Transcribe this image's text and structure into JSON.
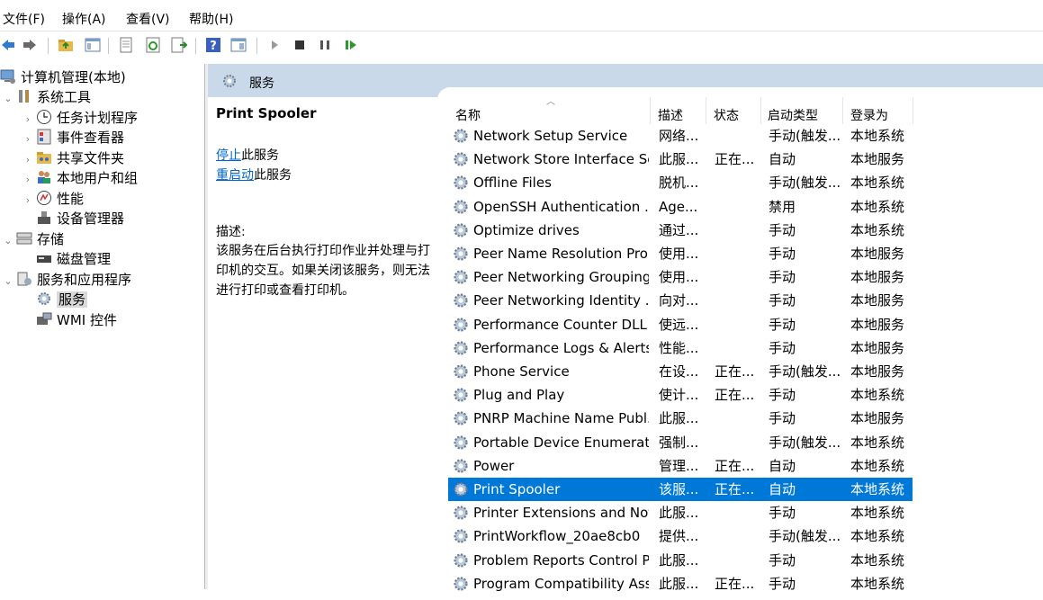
{
  "menubar": {
    "items": [
      "文件(F)",
      "操作(A)",
      "查看(V)",
      "帮助(H)"
    ]
  },
  "toolbar": {
    "buttons": [
      "back-icon",
      "forward-icon",
      "up-folder-icon",
      "show-hide-tree-icon",
      "properties-icon",
      "refresh-icon",
      "export-list-icon",
      "help-icon",
      "show-action-pane-icon",
      "play-icon",
      "stop-icon",
      "pause-icon",
      "resume-icon"
    ]
  },
  "tree": {
    "root": "计算机管理(本地)",
    "system_tools": "系统工具",
    "task_scheduler": "任务计划程序",
    "event_viewer": "事件查看器",
    "shared_folders": "共享文件夹",
    "local_users": "本地用户和组",
    "performance": "性能",
    "device_manager": "设备管理器",
    "storage": "存储",
    "disk_management": "磁盘管理",
    "services_apps": "服务和应用程序",
    "services": "服务",
    "wmi": "WMI 控件"
  },
  "services_header": {
    "title": "服务"
  },
  "details": {
    "service_name": "Print Spooler",
    "stop_link": "停止",
    "stop_suffix": "此服务",
    "restart_link": "重启动",
    "restart_suffix": "此服务",
    "desc_label": "描述:",
    "description": "该服务在后台执行打印作业并处理与打印机的交互。如果关闭该服务，则无法进行打印或查看打印机。"
  },
  "columns": {
    "name": "名称",
    "desc": "描述",
    "status": "状态",
    "startup": "启动类型",
    "logon": "登录为"
  },
  "rows": [
    {
      "name": "Network Setup Service",
      "desc": "网络...",
      "status": "",
      "startup": "手动(触发...",
      "logon": "本地系统"
    },
    {
      "name": "Network Store Interface Se...",
      "desc": "此服...",
      "status": "正在...",
      "startup": "自动",
      "logon": "本地服务"
    },
    {
      "name": "Offline Files",
      "desc": "脱机...",
      "status": "",
      "startup": "手动(触发...",
      "logon": "本地系统"
    },
    {
      "name": "OpenSSH Authentication ...",
      "desc": "Age...",
      "status": "",
      "startup": "禁用",
      "logon": "本地系统"
    },
    {
      "name": "Optimize drives",
      "desc": "通过...",
      "status": "",
      "startup": "手动",
      "logon": "本地系统"
    },
    {
      "name": "Peer Name Resolution Pro...",
      "desc": "使用...",
      "status": "",
      "startup": "手动",
      "logon": "本地服务"
    },
    {
      "name": "Peer Networking Grouping",
      "desc": "使用...",
      "status": "",
      "startup": "手动",
      "logon": "本地服务"
    },
    {
      "name": "Peer Networking Identity ...",
      "desc": "向对...",
      "status": "",
      "startup": "手动",
      "logon": "本地服务"
    },
    {
      "name": "Performance Counter DLL ...",
      "desc": "使远...",
      "status": "",
      "startup": "手动",
      "logon": "本地服务"
    },
    {
      "name": "Performance Logs & Alerts",
      "desc": "性能...",
      "status": "",
      "startup": "手动",
      "logon": "本地服务"
    },
    {
      "name": "Phone Service",
      "desc": "在设...",
      "status": "正在...",
      "startup": "手动(触发...",
      "logon": "本地服务"
    },
    {
      "name": "Plug and Play",
      "desc": "使计...",
      "status": "正在...",
      "startup": "手动",
      "logon": "本地系统"
    },
    {
      "name": "PNRP Machine Name Publ...",
      "desc": "此服...",
      "status": "",
      "startup": "手动",
      "logon": "本地服务"
    },
    {
      "name": "Portable Device Enumerat...",
      "desc": "强制...",
      "status": "",
      "startup": "手动(触发...",
      "logon": "本地系统"
    },
    {
      "name": "Power",
      "desc": "管理...",
      "status": "正在...",
      "startup": "自动",
      "logon": "本地系统"
    },
    {
      "name": "Print Spooler",
      "desc": "该服...",
      "status": "正在...",
      "startup": "自动",
      "logon": "本地系统",
      "selected": true
    },
    {
      "name": "Printer Extensions and Noti...",
      "desc": "此服...",
      "status": "",
      "startup": "手动",
      "logon": "本地系统"
    },
    {
      "name": "PrintWorkflow_20ae8cb0",
      "desc": "提供...",
      "status": "",
      "startup": "手动(触发...",
      "logon": "本地系统"
    },
    {
      "name": "Problem Reports Control P...",
      "desc": "此服...",
      "status": "",
      "startup": "手动",
      "logon": "本地系统"
    },
    {
      "name": "Program Compatibility Assi...",
      "desc": "此服...",
      "status": "正在...",
      "startup": "手动",
      "logon": "本地系统"
    }
  ],
  "colors": {
    "selection": "#0078d7",
    "header_band": "#cad9ea",
    "link": "#0066cc"
  }
}
